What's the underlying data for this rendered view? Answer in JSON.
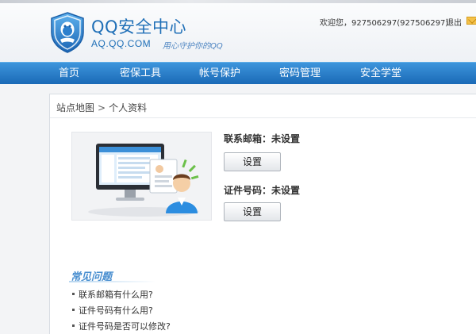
{
  "header": {
    "brand_title": "QQ安全中心",
    "brand_domain": "AQ.QQ.COM",
    "brand_slogan": "用心守护你的QQ",
    "welcome_text": "欢迎您，927506297(927506297)",
    "logout_label": "退出",
    "icons": {
      "logo": "qq-shield-logo-icon",
      "mail": "mail-icon"
    }
  },
  "nav": {
    "items": [
      {
        "label": "首页"
      },
      {
        "label": "密保工具"
      },
      {
        "label": "帐号保护"
      },
      {
        "label": "密码管理"
      },
      {
        "label": "安全学堂"
      }
    ]
  },
  "breadcrumb": {
    "root": "站点地图",
    "separator": ">",
    "current": "个人资料"
  },
  "profile": {
    "email_label": "联系邮箱：未设置",
    "email_button": "设置",
    "id_label": "证件号码：未设置",
    "id_button": "设置"
  },
  "faq": {
    "title": "常见问题",
    "items": [
      {
        "text": "联系邮箱有什么用?"
      },
      {
        "text": "证件号码有什么用?"
      },
      {
        "text": "证件号码是否可以修改?"
      }
    ]
  },
  "colors": {
    "brand_blue": "#1f6fb7",
    "nav_top": "#3d95dc",
    "nav_bottom": "#1a69b6",
    "faq_title": "#4a8fd0"
  }
}
